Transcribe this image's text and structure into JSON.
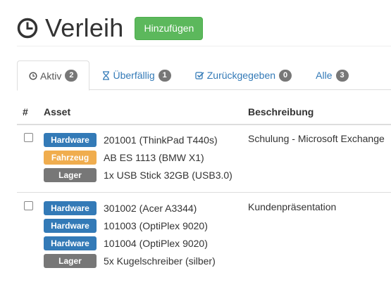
{
  "header": {
    "title": "Verleih",
    "add_button": "Hinzufügen",
    "icon": "clock-icon"
  },
  "tabs": [
    {
      "label": "Aktiv",
      "count": "2",
      "icon": "clock-icon",
      "active": true
    },
    {
      "label": "Überfällig",
      "count": "1",
      "icon": "hourglass-icon",
      "active": false
    },
    {
      "label": "Zurückgegeben",
      "count": "0",
      "icon": "check-square-icon",
      "active": false
    },
    {
      "label": "Alle",
      "count": "3",
      "icon": "",
      "active": false
    }
  ],
  "table": {
    "columns": {
      "num": "#",
      "asset": "Asset",
      "description": "Beschreibung"
    },
    "rows": [
      {
        "assets": [
          {
            "type": "Hardware",
            "name": "201001 (ThinkPad T440s)"
          },
          {
            "type": "Fahrzeug",
            "name": "AB ES 1113 (BMW X1)"
          },
          {
            "type": "Lager",
            "name": "1x USB Stick 32GB (USB3.0)"
          }
        ],
        "description": "Schulung - Microsoft Exchange"
      },
      {
        "assets": [
          {
            "type": "Hardware",
            "name": "301002 (Acer A3344)"
          },
          {
            "type": "Hardware",
            "name": "101003 (OptiPlex 9020)"
          },
          {
            "type": "Hardware",
            "name": "101004 (OptiPlex 9020)"
          },
          {
            "type": "Lager",
            "name": "5x Kugelschreiber (silber)"
          }
        ],
        "description": "Kundenpräsentation"
      }
    ]
  },
  "colors": {
    "success": "#5cb85c",
    "primary": "#337ab7",
    "warning": "#f0ad4e",
    "default": "#777777"
  }
}
